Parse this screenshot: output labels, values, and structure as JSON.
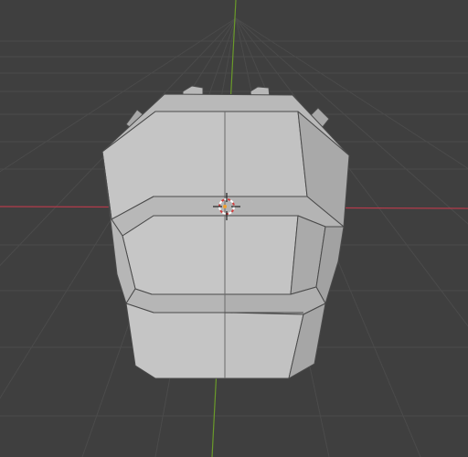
{
  "viewport": {
    "name": "3D Viewport",
    "background_color": "#3f3f3f",
    "grid_color": "#4b4b4b",
    "x_axis_color": "#b33b4b",
    "y_axis_color": "#6a9a2a"
  },
  "object": {
    "type": "mesh",
    "shading": "solid",
    "face_light": "#c4c4c4",
    "face_mid": "#b3b3b3",
    "face_dark": "#9a9a9a",
    "edge_color": "#4a4a4a"
  },
  "icons": {
    "cursor": "3d-cursor-icon"
  }
}
